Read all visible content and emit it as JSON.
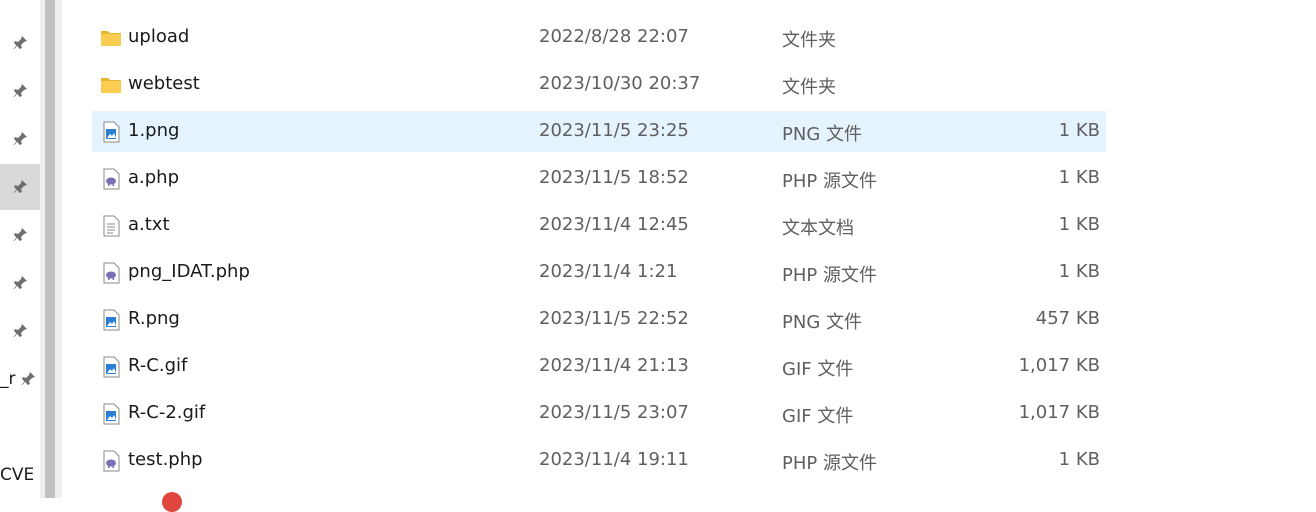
{
  "sidebar": {
    "partial_labels": [
      "_r",
      "CVE"
    ]
  },
  "files": [
    {
      "name": "upload",
      "date": "2022/8/28 22:07",
      "type": "文件夹",
      "size": "",
      "icon": "folder-icon"
    },
    {
      "name": "webtest",
      "date": "2023/10/30 20:37",
      "type": "文件夹",
      "size": "",
      "icon": "folder-icon"
    },
    {
      "name": "1.png",
      "date": "2023/11/5 23:25",
      "type": "PNG 文件",
      "size": "1 KB",
      "icon": "image-file-icon",
      "selected": true
    },
    {
      "name": "a.php",
      "date": "2023/11/5 18:52",
      "type": "PHP 源文件",
      "size": "1 KB",
      "icon": "php-file-icon"
    },
    {
      "name": "a.txt",
      "date": "2023/11/4 12:45",
      "type": "文本文档",
      "size": "1 KB",
      "icon": "text-file-icon"
    },
    {
      "name": "png_IDAT.php",
      "date": "2023/11/4 1:21",
      "type": "PHP 源文件",
      "size": "1 KB",
      "icon": "php-file-icon"
    },
    {
      "name": "R.png",
      "date": "2023/11/5 22:52",
      "type": "PNG 文件",
      "size": "457 KB",
      "icon": "image-file-icon"
    },
    {
      "name": "R-C.gif",
      "date": "2023/11/4 21:13",
      "type": "GIF 文件",
      "size": "1,017 KB",
      "icon": "image-file-icon"
    },
    {
      "name": "R-C-2.gif",
      "date": "2023/11/5 23:07",
      "type": "GIF 文件",
      "size": "1,017 KB",
      "icon": "image-file-icon"
    },
    {
      "name": "test.php",
      "date": "2023/11/4 19:11",
      "type": "PHP 源文件",
      "size": "1 KB",
      "icon": "php-file-icon"
    }
  ],
  "colors": {
    "selected_row": "#e5f3ff",
    "folder": "#f8c84a",
    "php": "#7a70b8",
    "image": "#2a7fd4"
  }
}
